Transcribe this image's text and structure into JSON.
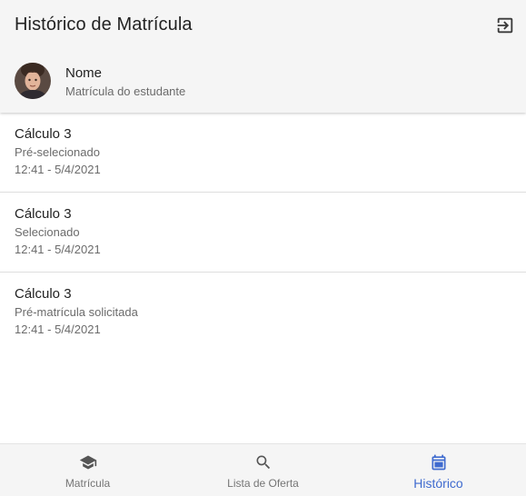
{
  "header": {
    "title": "Histórico de Matrícula",
    "action_icon": "logout-icon"
  },
  "user": {
    "name": "Nome",
    "subtitle": "Matrícula do estudante",
    "avatar_icon": "avatar-photo"
  },
  "history": [
    {
      "course": "Cálculo 3",
      "status": "Pré-selecionado",
      "time": "12:41 - 5/4/2021"
    },
    {
      "course": "Cálculo 3",
      "status": "Selecionado",
      "time": "12:41 - 5/4/2021"
    },
    {
      "course": "Cálculo 3",
      "status": "Pré-matrícula solicitada",
      "time": "12:41 - 5/4/2021"
    }
  ],
  "bottom_nav": {
    "active": "Histórico",
    "items": [
      {
        "label": "Matrícula",
        "icon": "school-icon"
      },
      {
        "label": "Lista de Oferta",
        "icon": "search-icon"
      },
      {
        "label": "Histórico",
        "icon": "calendar-icon"
      }
    ]
  },
  "colors": {
    "accent": "#3f6bcf",
    "header_bg": "#f5f5f5",
    "muted_text": "#6b6b6b"
  }
}
